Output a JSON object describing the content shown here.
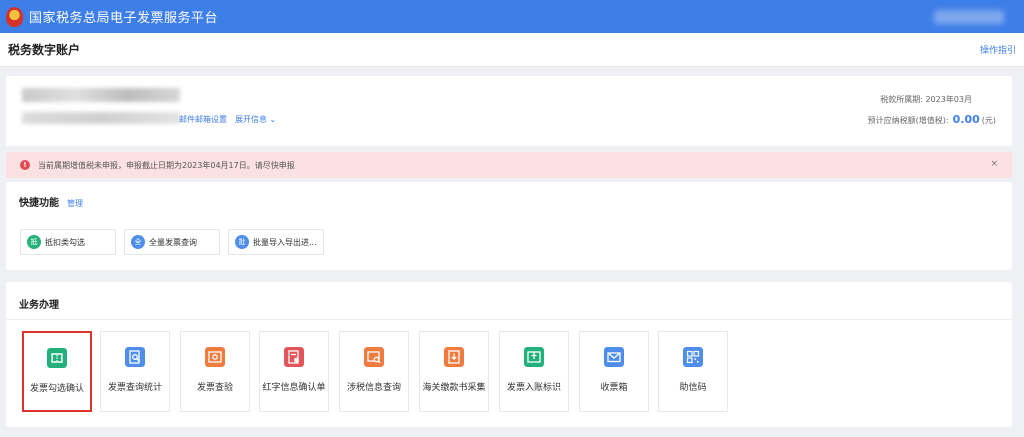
{
  "app": {
    "title": "国家税务总局电子发票服务平台"
  },
  "page": {
    "title": "税务数字账户",
    "guide": "操作指引"
  },
  "account": {
    "links": [
      "邮件邮箱设置",
      "展开信息 ⌄"
    ],
    "period_label": "税款所属期:",
    "period_value": "2023年03月",
    "tax_label": "预计应纳税额(增值税):",
    "tax_value": "0.00",
    "tax_unit": "(元)"
  },
  "alert": {
    "text": "当前属期增值税未申报，申报截止日期为2023年04月17日。请尽快申报",
    "close": "×"
  },
  "quick": {
    "title": "快捷功能",
    "manage": "管理",
    "items": [
      {
        "badge": "抵",
        "label": "抵扣类勾选",
        "color": "#26b37a"
      },
      {
        "badge": "全",
        "label": "全量发票查询",
        "color": "#4e8eea"
      },
      {
        "badge": "批",
        "label": "批量导入导出进...",
        "color": "#4e8eea"
      }
    ]
  },
  "business": {
    "title": "业务办理",
    "tiles": [
      {
        "label": "发票勾选确认",
        "icon": "invoice-check-icon",
        "color": "#22b07d"
      },
      {
        "label": "发票查询统计",
        "icon": "invoice-search-icon",
        "color": "#4e8eea"
      },
      {
        "label": "发票查验",
        "icon": "invoice-verify-icon",
        "color": "#f07b3f"
      },
      {
        "label": "红字信息确认单",
        "icon": "red-letter-icon",
        "color": "#e2555a"
      },
      {
        "label": "涉税信息查询",
        "icon": "tax-info-icon",
        "color": "#f07b3f"
      },
      {
        "label": "海关缴款书采集",
        "icon": "customs-payment-icon",
        "color": "#f07b3f"
      },
      {
        "label": "发票入账标识",
        "icon": "invoice-posting-icon",
        "color": "#22b07d"
      },
      {
        "label": "收票箱",
        "icon": "inbox-icon",
        "color": "#4e8eea"
      },
      {
        "label": "助信码",
        "icon": "qr-code-icon",
        "color": "#4e8eea"
      }
    ]
  }
}
